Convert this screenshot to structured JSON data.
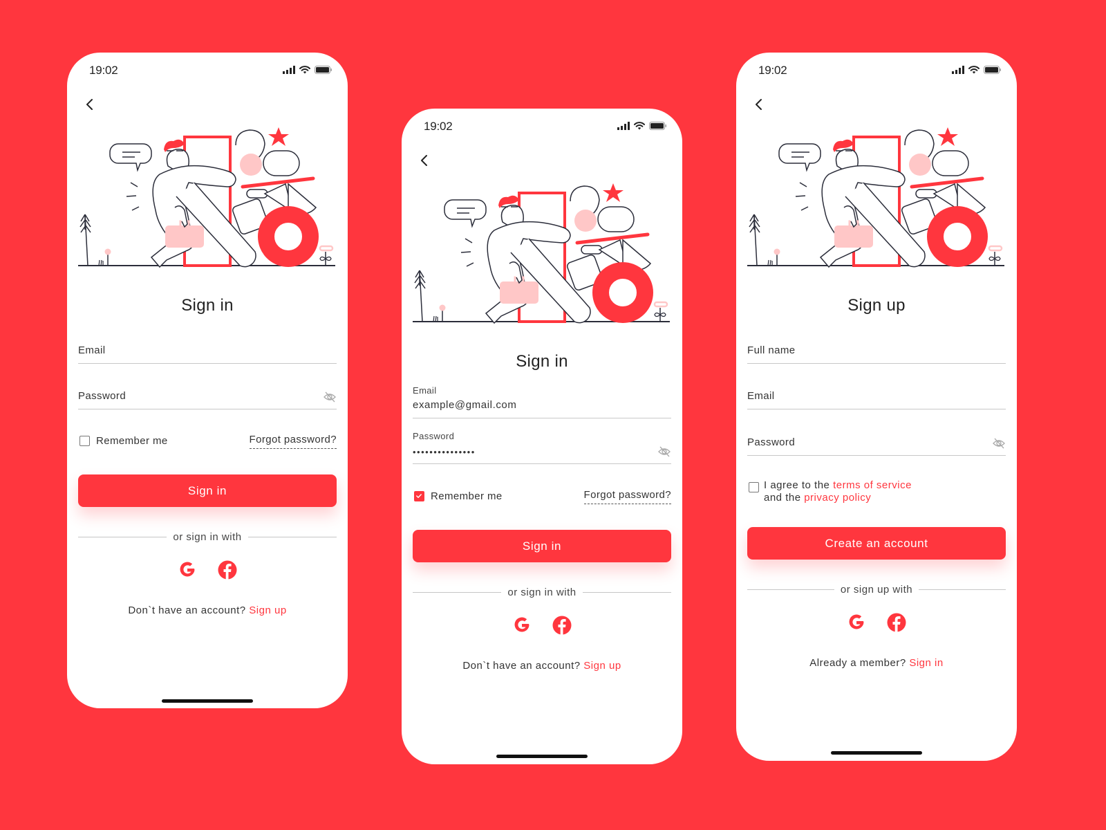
{
  "colors": {
    "background": "#ff363e",
    "accent": "#ff363e",
    "pink": "#ffc7c7",
    "ink": "#2b2d3a"
  },
  "status_bar": {
    "time": "19:02",
    "icons": [
      "signal-icon",
      "wifi-icon",
      "battery-icon"
    ]
  },
  "screens": [
    {
      "title": "Sign in",
      "fields": [
        {
          "label": "Email",
          "value": ""
        },
        {
          "label": "Password",
          "value": ""
        }
      ],
      "remember_label": "Remember me",
      "remember_checked": false,
      "forgot_label": "Forgot password?",
      "button_label": "Sign in",
      "divider_text": "or sign in with",
      "socials": [
        "google-icon",
        "facebook-icon"
      ],
      "footer_text": "Don`t have an account?",
      "footer_link": "Sign up"
    },
    {
      "title": "Sign in",
      "fields": [
        {
          "label": "Email",
          "value": "example@gmail.com"
        },
        {
          "label": "Password",
          "value": "•••••••••••••••"
        }
      ],
      "remember_label": "Remember me",
      "remember_checked": true,
      "forgot_label": "Forgot password?",
      "button_label": "Sign in",
      "divider_text": "or sign in with",
      "socials": [
        "google-icon",
        "facebook-icon"
      ],
      "footer_text": "Don`t have an account?",
      "footer_link": "Sign up"
    },
    {
      "title": "Sign up",
      "fields": [
        {
          "label": "Full name",
          "value": ""
        },
        {
          "label": "Email",
          "value": ""
        },
        {
          "label": "Password",
          "value": ""
        }
      ],
      "agree_prefix": "I agree to the",
      "agree_terms": "terms of service",
      "agree_mid": "and the",
      "agree_privacy": "privacy policy",
      "agree_checked": false,
      "button_label": "Create an account",
      "divider_text": "or sign up with",
      "socials": [
        "google-icon",
        "facebook-icon"
      ],
      "footer_text": "Already a member?",
      "footer_link": "Sign in"
    }
  ]
}
